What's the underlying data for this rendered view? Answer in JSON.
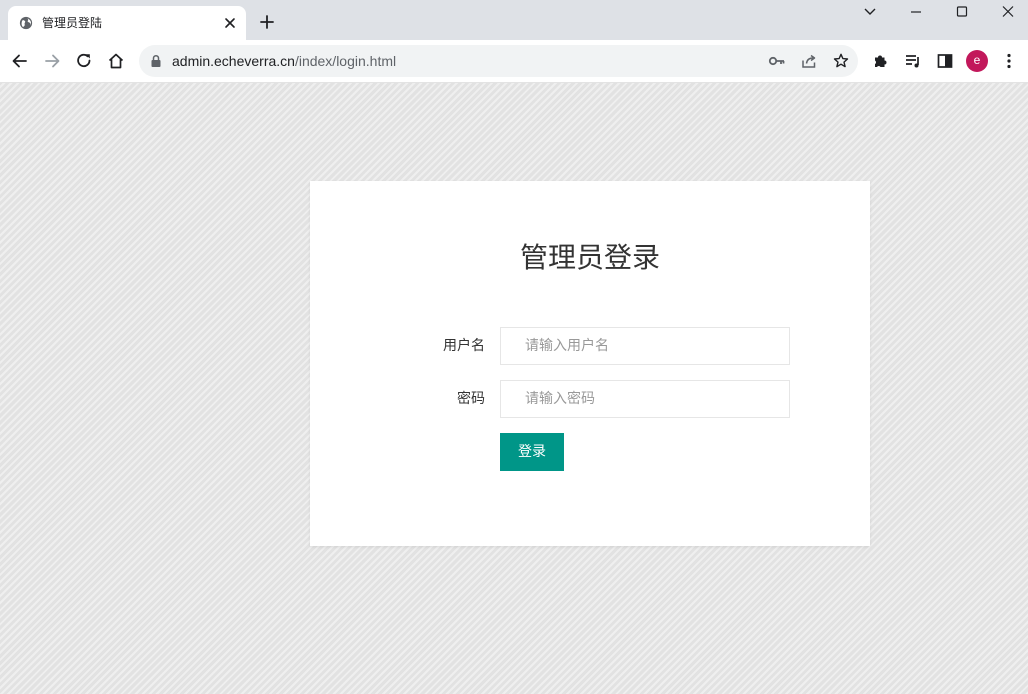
{
  "browser": {
    "tab": {
      "title": "管理员登陆",
      "favicon": "globe-icon"
    },
    "url": {
      "host": "admin.echeverra.cn",
      "path": "/index/login.html"
    },
    "profile_initial": "e",
    "profile_color": "#c2185b"
  },
  "login": {
    "title": "管理员登录",
    "username_label": "用户名",
    "username_placeholder": "请输入用户名",
    "password_label": "密码",
    "password_placeholder": "请输入密码",
    "submit_label": "登录",
    "accent_color": "#009688"
  }
}
